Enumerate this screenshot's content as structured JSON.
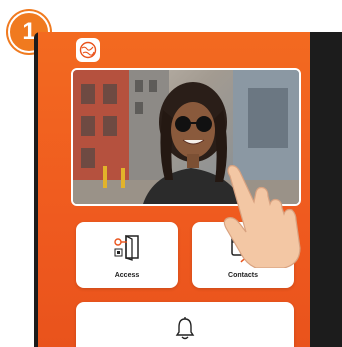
{
  "step": {
    "number": "1"
  },
  "colors": {
    "accent": "#f07a1f",
    "screen": "#ef5a1f",
    "icon_orange": "#e9531c"
  },
  "icons": {
    "app": "globe-logo-icon",
    "access": "door-key-icon",
    "contacts": "calendar-contacts-icon",
    "bell": "bell-icon",
    "hand": "tap-hand-icon"
  },
  "cards": {
    "access_label": "Access",
    "contacts_label": "Contacts"
  }
}
